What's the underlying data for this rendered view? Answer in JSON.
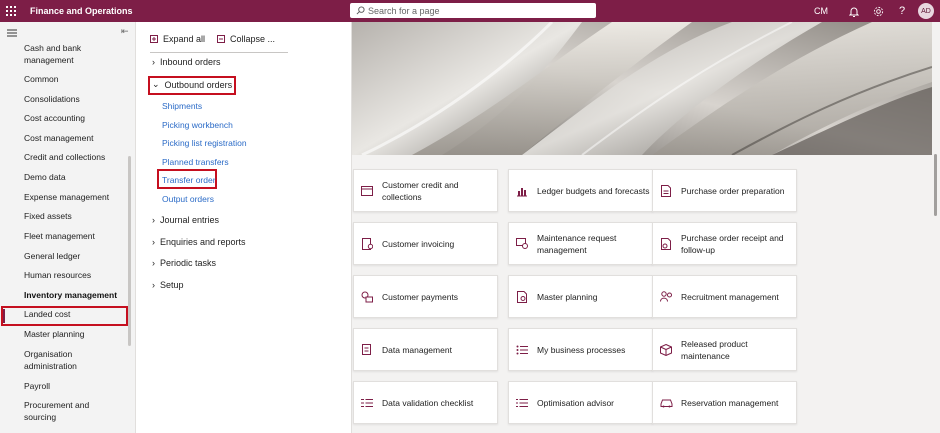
{
  "app": {
    "title": "Finance and Operations",
    "user_initials": "CM",
    "avatar_initials": "AD"
  },
  "search": {
    "placeholder": "Search for a page"
  },
  "nav": {
    "items": [
      "Cash and bank management",
      "Common",
      "Consolidations",
      "Cost accounting",
      "Cost management",
      "Credit and collections",
      "Demo data",
      "Expense management",
      "Fixed assets",
      "Fleet management",
      "General ledger",
      "Human resources",
      "Inventory management",
      "Landed cost",
      "Master planning",
      "Organisation administration",
      "Payroll",
      "Procurement and sourcing"
    ],
    "selected": "Inventory management"
  },
  "flyout": {
    "expand_all": "Expand all",
    "collapse": "Collapse ...",
    "inbound_orders": "Inbound orders",
    "outbound_orders": "Outbound orders",
    "outbound_links": [
      "Shipments",
      "Picking workbench",
      "Picking list registration",
      "Planned transfers",
      "Transfer order",
      "Output orders"
    ],
    "journal_entries": "Journal entries",
    "enquiries_reports": "Enquiries and reports",
    "periodic_tasks": "Periodic tasks",
    "setup": "Setup"
  },
  "tiles": [
    {
      "label": "Customer credit and collections",
      "icon": "card-icon"
    },
    {
      "label": "Ledger budgets and forecasts",
      "icon": "chart-icon"
    },
    {
      "label": "Purchase order preparation",
      "icon": "document-icon"
    },
    {
      "label": "Customer invoicing",
      "icon": "invoice-icon"
    },
    {
      "label": "Maintenance request management",
      "icon": "maintenance-icon"
    },
    {
      "label": "Purchase order receipt and follow-up",
      "icon": "receipt-icon"
    },
    {
      "label": "Customer payments",
      "icon": "payments-icon"
    },
    {
      "label": "Master planning",
      "icon": "planning-icon"
    },
    {
      "label": "Recruitment management",
      "icon": "people-icon"
    },
    {
      "label": "Data management",
      "icon": "data-icon"
    },
    {
      "label": "My business processes",
      "icon": "list-icon"
    },
    {
      "label": "Released product maintenance",
      "icon": "box-icon"
    },
    {
      "label": "Data validation checklist",
      "icon": "checklist-icon"
    },
    {
      "label": "Optimisation advisor",
      "icon": "list-icon"
    },
    {
      "label": "Reservation management",
      "icon": "car-icon"
    }
  ],
  "colors": {
    "brand": "#7d1e47",
    "highlight": "#c50f1f",
    "link": "#2b6bc7"
  }
}
